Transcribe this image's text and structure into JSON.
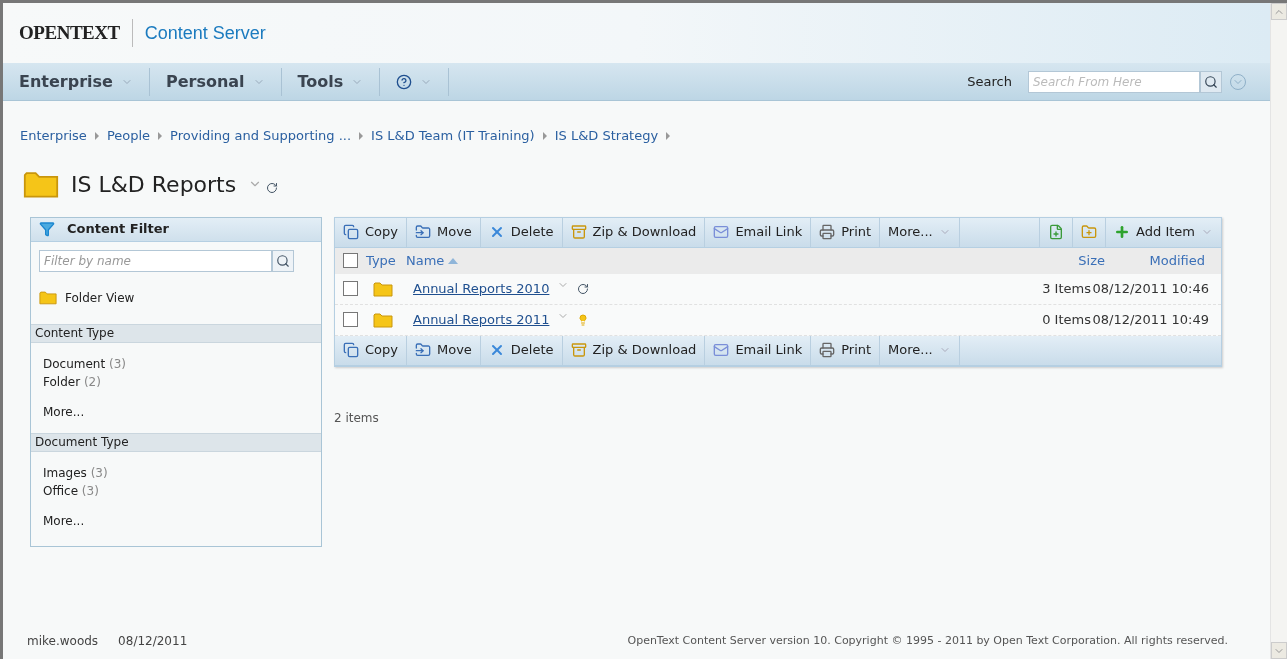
{
  "header": {
    "logo": "OPENTEXT",
    "product": "Content Server"
  },
  "nav": {
    "menus": [
      {
        "label": "Enterprise",
        "kind": "text"
      },
      {
        "label": "Personal",
        "kind": "text"
      },
      {
        "label": "Tools",
        "kind": "text"
      },
      {
        "kind": "help"
      }
    ],
    "search_label": "Search",
    "search": {
      "placeholder": "Search From Here"
    }
  },
  "breadcrumbs": [
    "Enterprise",
    "People",
    "Providing and Supporting ...",
    "IS L&D Team (IT Training)",
    "IS L&D Strategy"
  ],
  "title": "IS L&D Reports",
  "filter": {
    "title": "Content Filter",
    "search": {
      "placeholder": "Filter by name"
    },
    "folder_view": "Folder View",
    "sections": [
      {
        "title": "Content Type",
        "items": [
          {
            "label": "Document",
            "count": "(3)"
          },
          {
            "label": "Folder",
            "count": "(2)"
          }
        ],
        "more": "More..."
      },
      {
        "title": "Document Type",
        "items": [
          {
            "label": "Images",
            "count": "(3)"
          },
          {
            "label": "Office",
            "count": "(3)"
          }
        ],
        "more": "More..."
      }
    ]
  },
  "toolbar_top": [
    {
      "label": "Copy",
      "kind": "copy"
    },
    {
      "label": "Move",
      "kind": "move"
    },
    {
      "label": "Delete",
      "kind": "delete"
    },
    {
      "label": "Zip & Download",
      "kind": "zip"
    },
    {
      "label": "Email Link",
      "kind": "email"
    },
    {
      "label": "Print",
      "kind": "print"
    },
    {
      "label": "More...",
      "kind": "more"
    }
  ],
  "add_item": "Add Item",
  "select_all": {
    "checked": false
  },
  "columns": [
    {
      "label": "Type",
      "sorted": false
    },
    {
      "label": "Name",
      "sorted": true
    },
    {
      "label": "Size",
      "sorted": false
    },
    {
      "label": "Modified",
      "sorted": false
    }
  ],
  "rows": [
    {
      "name": "Annual Reports 2010",
      "size": "3 Items",
      "modified": "08/12/2011 10:46",
      "checked": false,
      "kind": "refresh"
    },
    {
      "name": "Annual Reports 2011",
      "size": "0 Items",
      "modified": "08/12/2011 10:49",
      "checked": false,
      "kind": "new"
    }
  ],
  "toolbar_bottom": [
    {
      "label": "Copy",
      "kind": "copy"
    },
    {
      "label": "Move",
      "kind": "move"
    },
    {
      "label": "Delete",
      "kind": "delete"
    },
    {
      "label": "Zip & Download",
      "kind": "zip"
    },
    {
      "label": "Email Link",
      "kind": "email"
    },
    {
      "label": "Print",
      "kind": "print"
    },
    {
      "label": "More...",
      "kind": "more"
    }
  ],
  "item_count": "2 items",
  "footer": {
    "user": "mike.woods",
    "date": "08/12/2011",
    "copyright": "OpenText Content Server version 10. Copyright © 1995 - 2011 by Open Text Corporation. All rights reserved."
  }
}
